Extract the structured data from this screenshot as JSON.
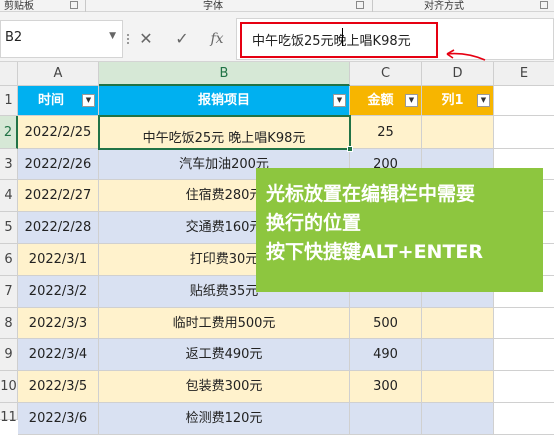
{
  "ribbon": {
    "groups": [
      "剪贴板",
      "字体",
      "对齐方式"
    ]
  },
  "namebox": {
    "value": "B2"
  },
  "formula_bar": {
    "cancel_icon": "✕",
    "enter_icon": "✓",
    "fx_label": "fx",
    "value_part1": "中午吃饭25元",
    "value_part2": "晚上唱K98元"
  },
  "columns": [
    "A",
    "B",
    "C",
    "D",
    "E"
  ],
  "row_numbers": [
    "1",
    "2",
    "3",
    "4",
    "5",
    "6",
    "7",
    "8",
    "9",
    "10",
    "11"
  ],
  "table": {
    "headers": [
      "时间",
      "报销项目",
      "金额",
      "列1"
    ],
    "rows": [
      {
        "date": "2022/2/25",
        "item": "中午吃饭25元 晚上唱K98元",
        "amount": "25"
      },
      {
        "date": "2022/2/26",
        "item": "汽车加油200元",
        "amount": "200"
      },
      {
        "date": "2022/2/27",
        "item": "住宿费280元",
        "amount": ""
      },
      {
        "date": "2022/2/28",
        "item": "交通费160元",
        "amount": ""
      },
      {
        "date": "2022/3/1",
        "item": "打印费30元",
        "amount": ""
      },
      {
        "date": "2022/3/2",
        "item": "贴纸费35元",
        "amount": ""
      },
      {
        "date": "2022/3/3",
        "item": "临时工费用500元",
        "amount": "500"
      },
      {
        "date": "2022/3/4",
        "item": "返工费490元",
        "amount": "490"
      },
      {
        "date": "2022/3/5",
        "item": "包装费300元",
        "amount": "300"
      },
      {
        "date": "2022/3/6",
        "item": "检测费120元",
        "amount": ""
      }
    ]
  },
  "callout": {
    "line1": "光标放置在编辑栏中需要",
    "line2": "换行的位置",
    "line3_prefix": "按下快捷键",
    "line3_key": "ALT+ENTER"
  },
  "colors": {
    "header_blue": "#00b0f0",
    "header_orange": "#f7b500",
    "band_yellow": "#fff2cc",
    "band_blue": "#d9e1f2",
    "callout_green": "#8dc63f",
    "highlight_red": "#e60012",
    "excel_green": "#217346"
  }
}
